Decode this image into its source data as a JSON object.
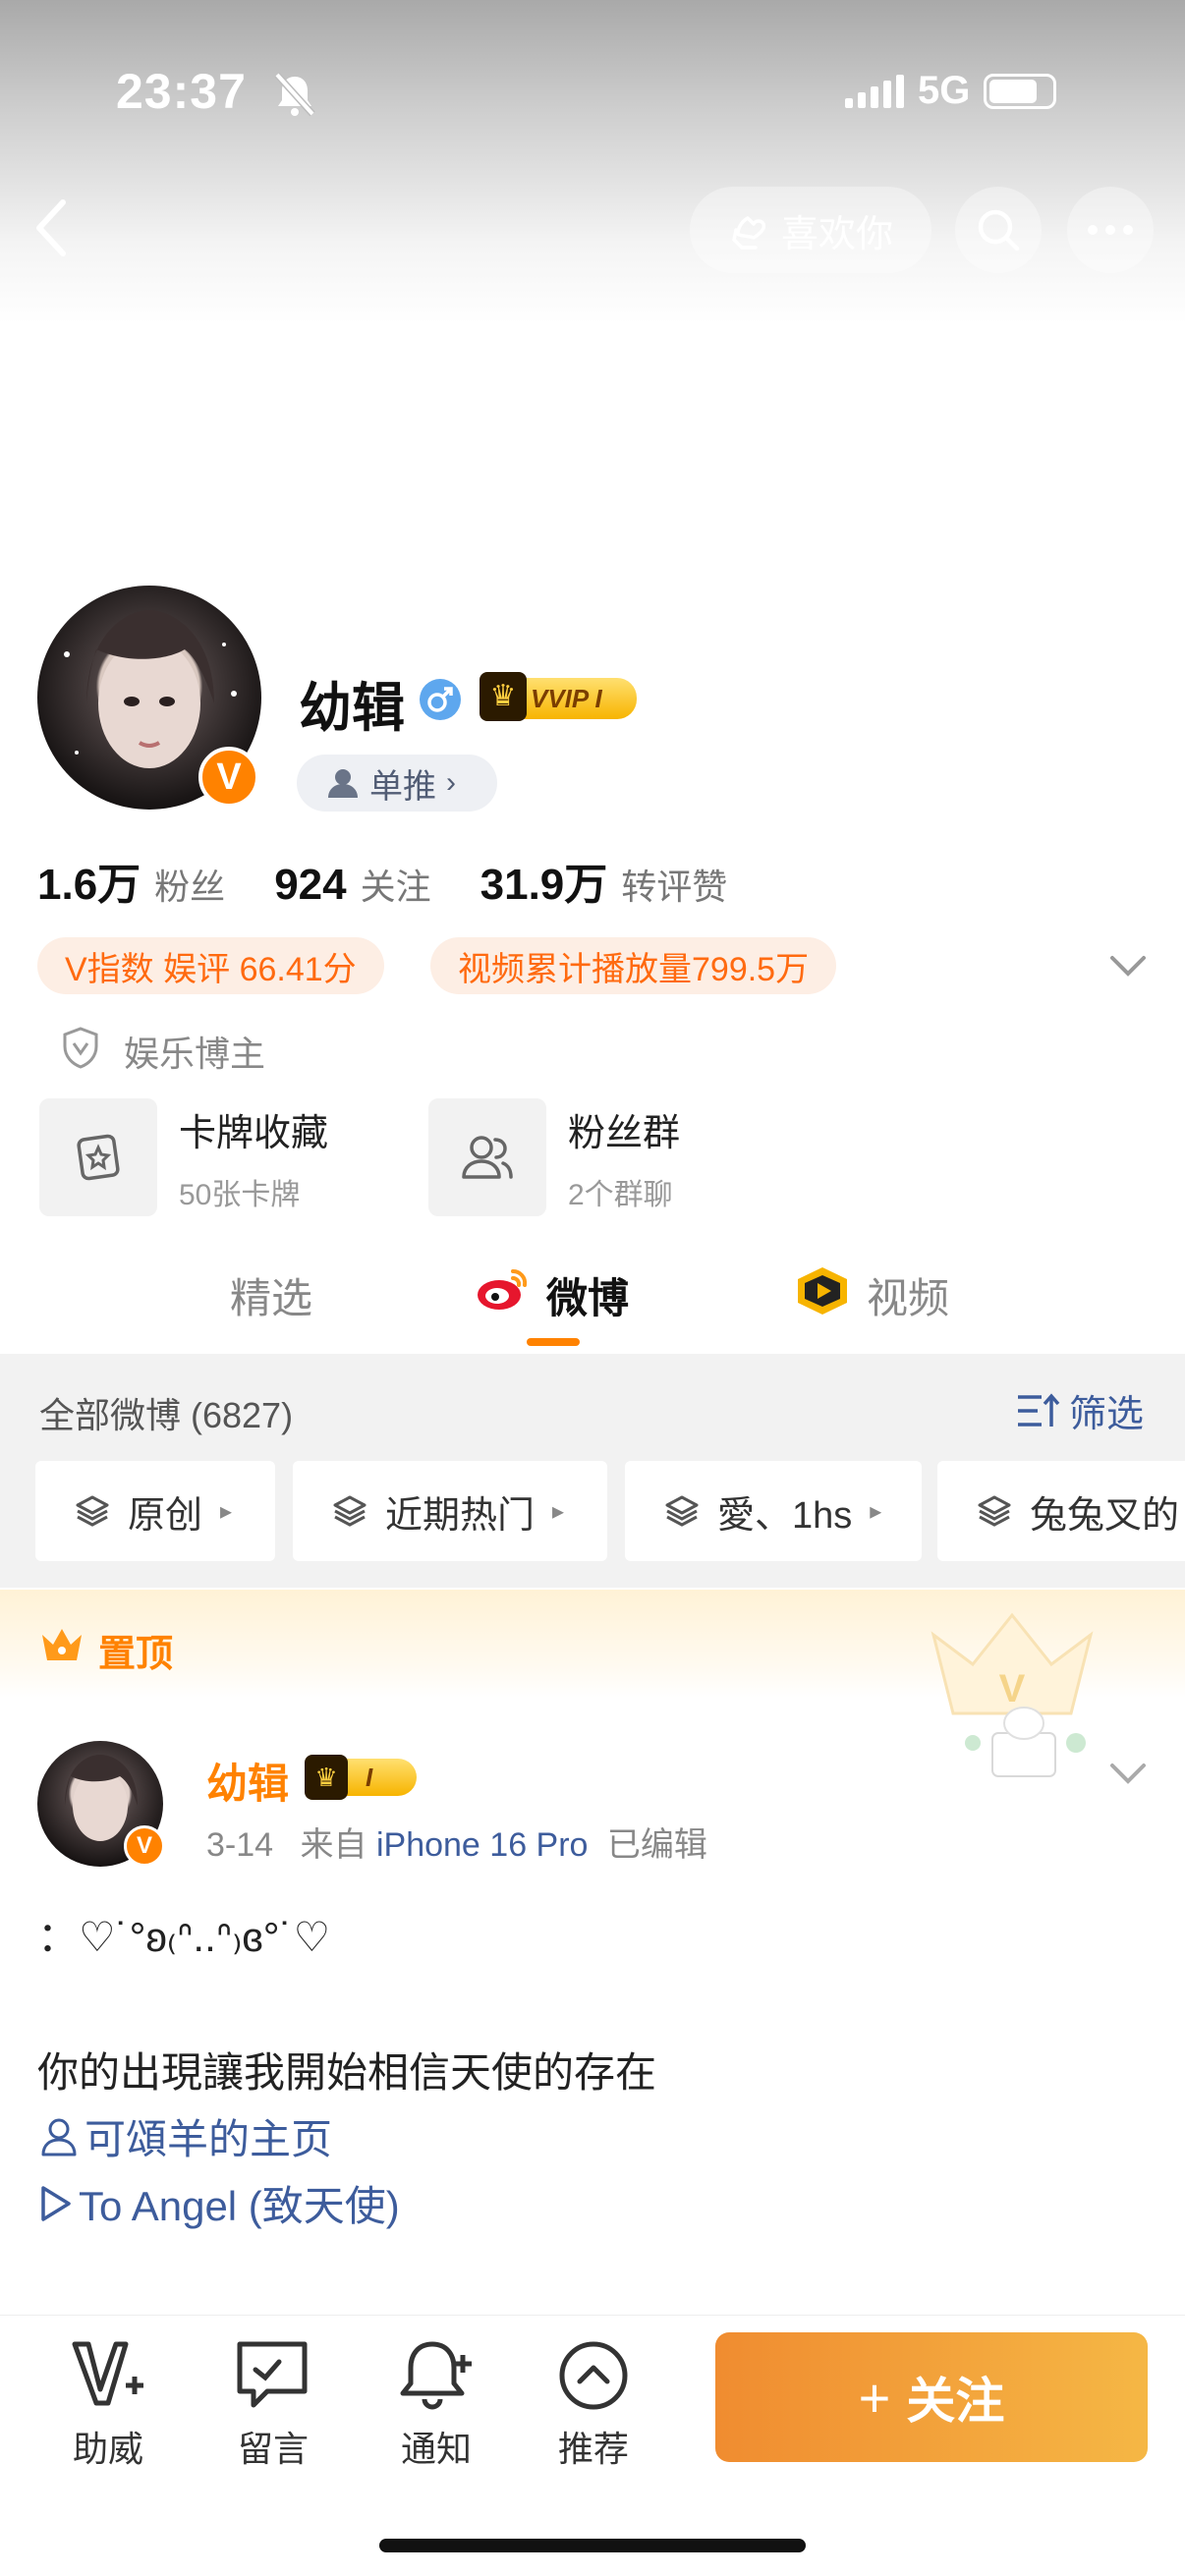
{
  "status": {
    "time": "23:37",
    "network": "5G"
  },
  "header": {
    "like_label": "喜欢你"
  },
  "profile": {
    "name": "幼辑",
    "vip": "VVIP I",
    "tag_button": "单推",
    "stats": [
      {
        "value": "1.6万",
        "label": "粉丝"
      },
      {
        "value": "924",
        "label": "关注"
      },
      {
        "value": "31.9万",
        "label": "转评赞"
      }
    ],
    "vindex": "V指数 娱评 66.41分",
    "video_views": "视频累计播放量799.5万",
    "category": "娱乐博主",
    "cards": [
      {
        "title": "卡牌收藏",
        "sub": "50张卡牌",
        "icon": "card-icon"
      },
      {
        "title": "粉丝群",
        "sub": "2个群聊",
        "icon": "group-icon"
      }
    ]
  },
  "tabs": [
    "精选",
    "微博",
    "视频"
  ],
  "feed": {
    "count_label": "全部微博 (6827)",
    "filter_label": "筛选",
    "chips": [
      "原创",
      "近期热门",
      "愛、1hs",
      "兔兔叉的"
    ],
    "pinned_label": "置顶"
  },
  "post": {
    "author": "幼辑",
    "vip": "I",
    "date": "3-14",
    "source_prefix": "来自",
    "device": "iPhone 16 Pro",
    "edited": "已编辑",
    "line1": "：♡˙°ʚ₍ᐢ..ᐢ₎ɞ°˙♡",
    "line2": "你的出現讓我開始相信天使的存在",
    "link1": "可頌羊的主页",
    "link2": "To Angel (致天使)"
  },
  "bottom_nav": [
    {
      "label": "助威",
      "icon": "cheer-icon"
    },
    {
      "label": "留言",
      "icon": "message-icon"
    },
    {
      "label": "通知",
      "icon": "bell-icon"
    },
    {
      "label": "推荐",
      "icon": "recommend-icon"
    }
  ],
  "follow_label": "关注",
  "colors": {
    "accent": "#ff8200",
    "link": "#3d5c9c",
    "follow_start": "#f08c30",
    "follow_end": "#f5b745"
  }
}
